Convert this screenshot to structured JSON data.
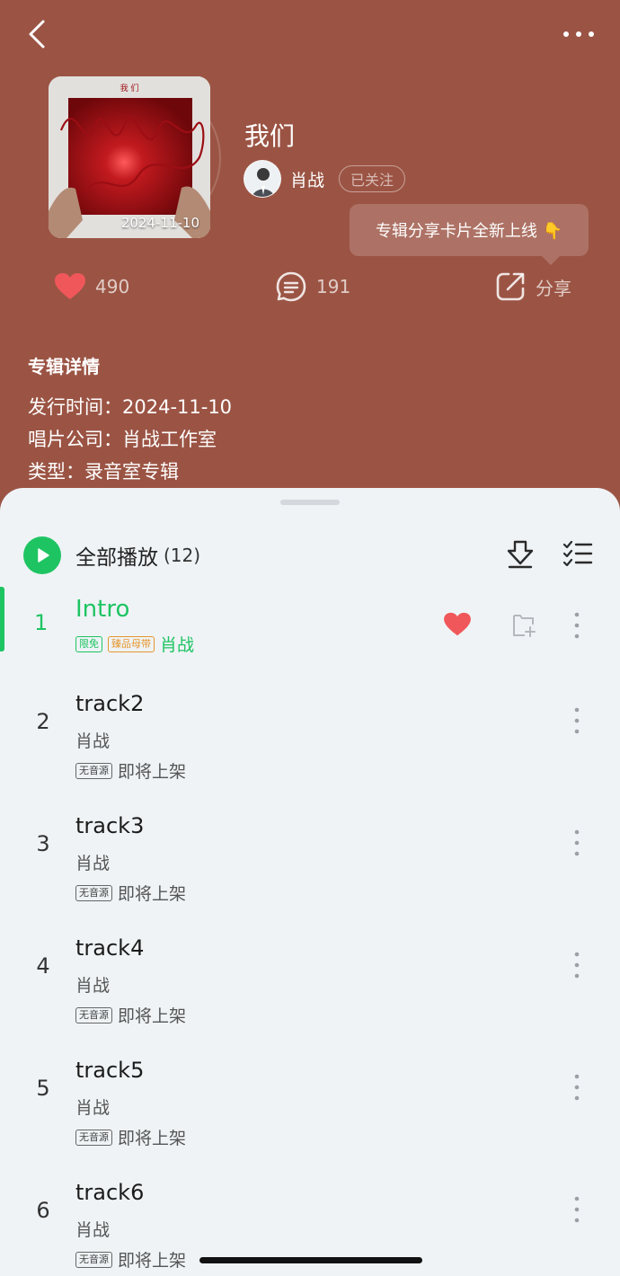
{
  "header": {
    "back_icon": "chevron-left-icon",
    "more_icon": "more-horizontal-icon"
  },
  "album": {
    "title": "我们",
    "cover_date": "2024-11-10",
    "cover_caption": "我 们",
    "artist_name": "肖战",
    "follow_label": "已关注",
    "tooltip_text": "专辑分享卡片全新上线 👇"
  },
  "actions": {
    "like_count": "490",
    "comment_count": "191",
    "share_label": "分享"
  },
  "details": {
    "title": "专辑详情",
    "release": "发行时间：2024-11-10",
    "company": "唱片公司：肖战工作室",
    "type": "类型：录音室专辑"
  },
  "playlist": {
    "play_all_label": "全部播放",
    "count": "(12)"
  },
  "first_track": {
    "index": "1",
    "name": "Intro",
    "tag_free": "限免",
    "tag_vinyl": "臻品母带",
    "artist": "肖战"
  },
  "tracks": [
    {
      "index": "2",
      "name": "track2",
      "artist": "肖战",
      "tag": "无音源",
      "status": "即将上架"
    },
    {
      "index": "3",
      "name": "track3",
      "artist": "肖战",
      "tag": "无音源",
      "status": "即将上架"
    },
    {
      "index": "4",
      "name": "track4",
      "artist": "肖战",
      "tag": "无音源",
      "status": "即将上架"
    },
    {
      "index": "5",
      "name": "track5",
      "artist": "肖战",
      "tag": "无音源",
      "status": "即将上架"
    },
    {
      "index": "6",
      "name": "track6",
      "artist": "肖战",
      "tag": "无音源",
      "status": "即将上架"
    }
  ],
  "colors": {
    "background": "#9b5444",
    "sheet": "#eff3f6",
    "accent_green": "#1ec462",
    "heart_red": "#f0575a",
    "tag_orange": "#e5962e"
  }
}
